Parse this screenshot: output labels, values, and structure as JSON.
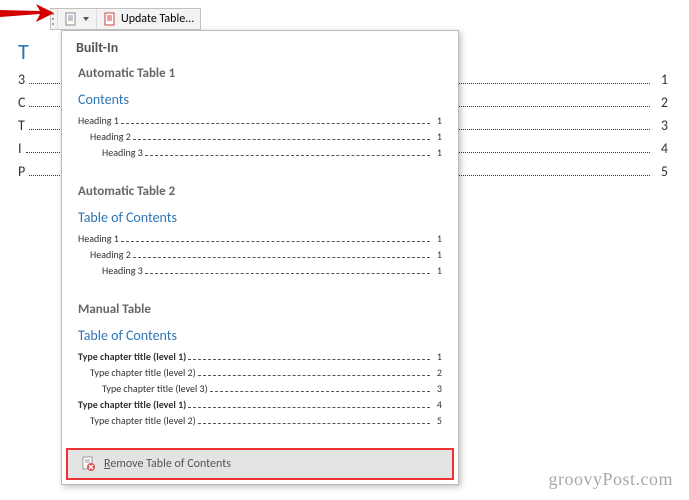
{
  "toolbar": {
    "update_label": "Update Table..."
  },
  "background_doc": {
    "title_letter": "T",
    "rows": [
      {
        "stub": "3",
        "page": "1"
      },
      {
        "stub": "C",
        "page": "2"
      },
      {
        "stub": "T",
        "page": "3"
      },
      {
        "stub": "I",
        "page": "4"
      },
      {
        "stub": "P",
        "page": "5"
      }
    ]
  },
  "gallery": {
    "category": "Built-In",
    "auto_table_1": {
      "title": "Automatic Table 1",
      "header": "Contents",
      "rows": [
        {
          "label": "Heading 1",
          "page": "1",
          "indent": 0
        },
        {
          "label": "Heading 2",
          "page": "1",
          "indent": 1
        },
        {
          "label": "Heading 3",
          "page": "1",
          "indent": 2
        }
      ]
    },
    "auto_table_2": {
      "title": "Automatic Table 2",
      "header": "Table of Contents",
      "rows": [
        {
          "label": "Heading 1",
          "page": "1",
          "indent": 0
        },
        {
          "label": "Heading 2",
          "page": "1",
          "indent": 1
        },
        {
          "label": "Heading 3",
          "page": "1",
          "indent": 2
        }
      ]
    },
    "manual_table": {
      "title": "Manual Table",
      "header": "Table of Contents",
      "rows": [
        {
          "label": "Type chapter title (level 1)",
          "page": "1",
          "indent": 0,
          "bold": true
        },
        {
          "label": "Type chapter title (level 2)",
          "page": "2",
          "indent": 1
        },
        {
          "label": "Type chapter title (level 3)",
          "page": "3",
          "indent": 2
        },
        {
          "label": "Type chapter title (level 1)",
          "page": "4",
          "indent": 0,
          "bold": true
        },
        {
          "label": "Type chapter title (level 2)",
          "page": "5",
          "indent": 1
        }
      ]
    },
    "remove": {
      "prefix": "R",
      "rest": "emove Table of Contents"
    }
  },
  "watermark": "groovyPost.com"
}
